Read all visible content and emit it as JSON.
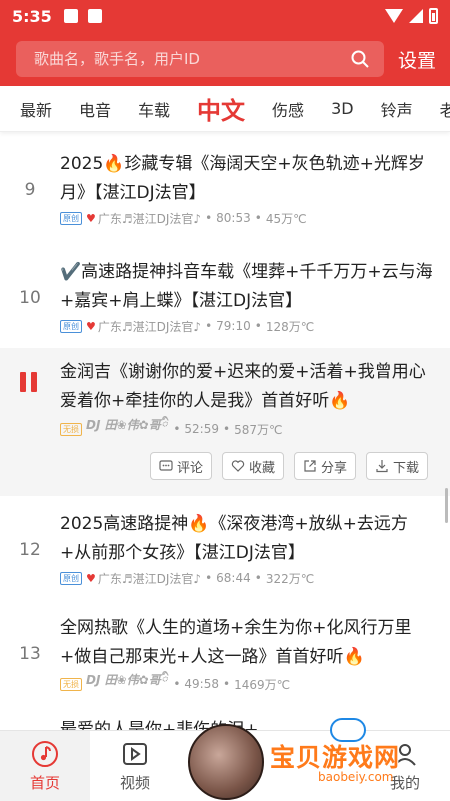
{
  "status": {
    "time": "5:35"
  },
  "search": {
    "placeholder": "歌曲名，歌手名，用户ID"
  },
  "header": {
    "settings_label": "设置"
  },
  "tabs": [
    {
      "label": "最新"
    },
    {
      "label": "电音"
    },
    {
      "label": "车载"
    },
    {
      "label": "中文",
      "active": true
    },
    {
      "label": "伤感"
    },
    {
      "label": "3D"
    },
    {
      "label": "铃声"
    },
    {
      "label": "老"
    }
  ],
  "songs": [
    {
      "number": "9",
      "title": "2025",
      "title_rest": "珍藏专辑《海阔天空+灰色轨迹+光辉岁月》【湛江DJ法官】",
      "badge": "原创",
      "uploader": "广东♬湛江DJ法官♪",
      "duration": "80:53",
      "plays": "45万℃"
    },
    {
      "number": "10",
      "title": "✔️高速路提神抖音车载《埋葬+千千万万+云与海+嘉宾+肩上蝶》【湛江DJ法官】",
      "badge": "原创",
      "uploader": "广东♬湛江DJ法官♪",
      "duration": "79:10",
      "plays": "128万℃"
    },
    {
      "number": "",
      "title": "金润吉《谢谢你的爱+迟来的爱+活着+我曾用心爱着你+牵挂你的人是我》首首好听",
      "badge": "无损",
      "uploader": "DJ 田❀伟✿哥ི ",
      "duration": "52:59",
      "plays": "587万℃"
    },
    {
      "number": "12",
      "title": "2025高速路提神",
      "title_rest": "《深夜港湾+放纵+去远方+从前那个女孩》【湛江DJ法官】",
      "badge": "原创",
      "uploader": "广东♬湛江DJ法官♪",
      "duration": "68:44",
      "plays": "322万℃"
    },
    {
      "number": "13",
      "title": "全网热歌《人生的道场+余生为你+化风行万里+做自己那束光+人这一路》首首好听",
      "badge": "无损",
      "uploader": "DJ 田❀伟✿哥ི ",
      "duration": "49:58",
      "plays": "1469万℃"
    },
    {
      "number": "",
      "title": "最爱的人是你+悲伤的泪+…",
      "badge": "",
      "uploader": "",
      "duration": "",
      "plays": ""
    }
  ],
  "actions": {
    "comment": "评论",
    "favorite": "收藏",
    "share": "分享",
    "download": "下载"
  },
  "meta_separator": "•",
  "bottom_nav": [
    {
      "label": "首页",
      "active": true
    },
    {
      "label": "视频"
    },
    {
      "label": "我的"
    }
  ],
  "watermark": {
    "text": "宝贝游戏网",
    "url": "baobeiy.com"
  },
  "colors": {
    "accent": "#e53935",
    "flame": "#ff7a00"
  }
}
